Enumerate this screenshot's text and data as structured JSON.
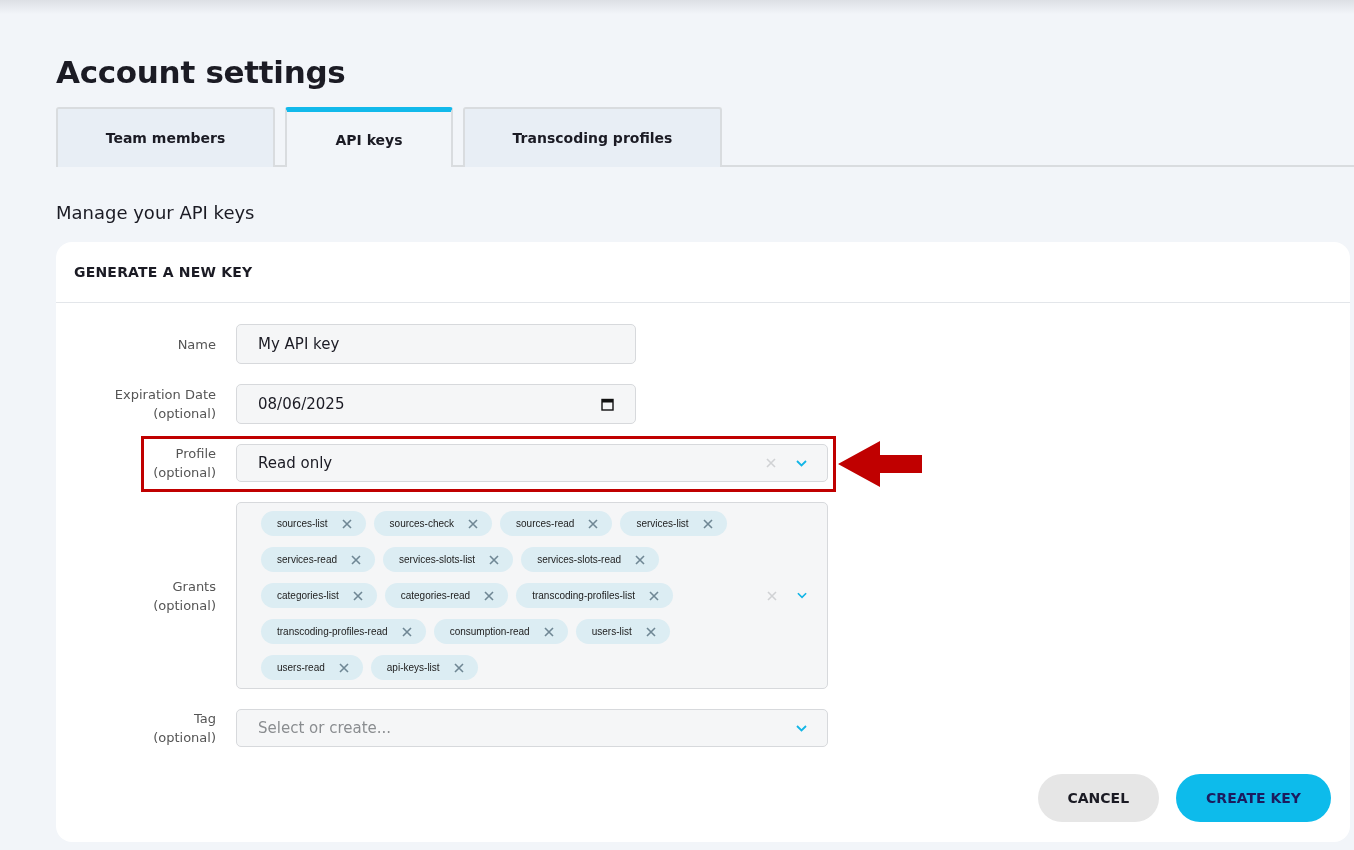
{
  "page": {
    "title": "Account settings",
    "subtitle": "Manage your API keys"
  },
  "tabs": [
    {
      "label": "Team members",
      "selected": false
    },
    {
      "label": "API keys",
      "selected": true
    },
    {
      "label": "Transcoding profiles",
      "selected": false
    }
  ],
  "card": {
    "title": "GENERATE A NEW KEY",
    "fields": [
      {
        "kind": "text",
        "label": "Name",
        "value": "My API key"
      },
      {
        "kind": "date",
        "label": "Expiration Date",
        "hint": "(optional)",
        "value": "08/06/2025"
      },
      {
        "kind": "select",
        "label": "Profile",
        "hint": "(optional)",
        "value": "Read only",
        "highlighted": true
      },
      {
        "kind": "multiselect",
        "label": "Grants",
        "hint": "(optional)",
        "chips": [
          "sources-list",
          "sources-check",
          "sources-read",
          "services-list",
          "services-read",
          "services-slots-list",
          "services-slots-read",
          "categories-list",
          "categories-read",
          "transcoding-profiles-list",
          "transcoding-profiles-read",
          "consumption-read",
          "users-list",
          "users-read",
          "api-keys-list"
        ]
      },
      {
        "kind": "combo",
        "label": "Tag",
        "hint": "(optional)",
        "placeholder": "Select or create..."
      }
    ],
    "buttons": [
      {
        "kind": "secondary",
        "label": "CANCEL"
      },
      {
        "kind": "primary",
        "label": "CREATE KEY"
      }
    ]
  }
}
